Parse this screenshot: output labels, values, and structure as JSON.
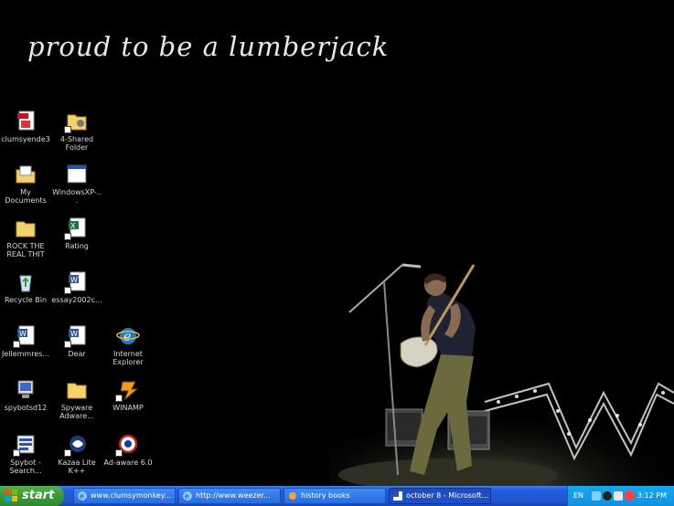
{
  "desktop": {
    "tagline": "proud to be a lumberjack",
    "icons": [
      {
        "label": "clumsyende3"
      },
      {
        "label": "4-Shared Folder"
      },
      {
        "label": "My Documents"
      },
      {
        "label": "WindowsXP-..."
      },
      {
        "label": "ROCK THE REAL THIT"
      },
      {
        "label": "Rating"
      },
      {
        "label": "Recycle Bin"
      },
      {
        "label": "essay2002c..."
      },
      {
        "label": "Jellemmres..."
      },
      {
        "label": "Dear"
      },
      {
        "label": "Internet Explorer"
      },
      {
        "label": "spybotsd12"
      },
      {
        "label": "Spyware Adware..."
      },
      {
        "label": "WINAMP"
      },
      {
        "label": "Spybot - Search..."
      },
      {
        "label": "Kazaa Lite K++"
      },
      {
        "label": "Ad-aware 6.0"
      }
    ]
  },
  "taskbar": {
    "start_label": "start",
    "tasks": [
      {
        "label": "www.clumsymonkey...",
        "active": false
      },
      {
        "label": "http://www.weezer...",
        "active": false
      },
      {
        "label": "history books",
        "active": false
      },
      {
        "label": "october 8 - Microsoft...",
        "active": true
      }
    ],
    "tray": {
      "language": "EN",
      "time": "3:12 PM"
    }
  },
  "colors": {
    "taskbar_blue": "#245edb",
    "start_green": "#3c9a3c",
    "tray_blue": "#17a7ef"
  }
}
